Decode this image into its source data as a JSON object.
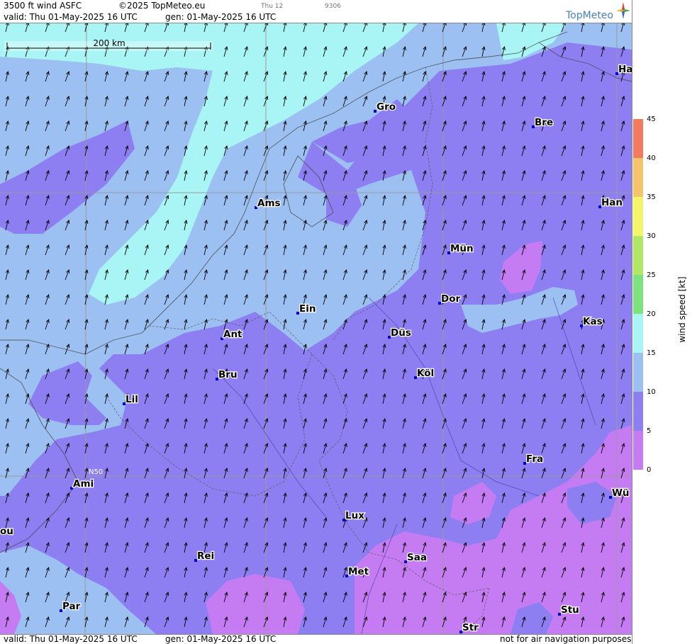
{
  "header": {
    "title": "3500 ft wind ASFC",
    "copyright": "©2025 TopMeteo.eu",
    "day_small": "Thu 12",
    "code_small": "9306",
    "valid": "valid:  Thu  01-May-2025  16 UTC",
    "gen": "gen: 01-May-2025 16 UTC",
    "logo": "TopMeteo"
  },
  "footer": {
    "valid": "valid:  Thu  01-May-2025  16 UTC",
    "gen": "gen: 01-May-2025 16 UTC",
    "disclaimer": "not for air navigation purposes"
  },
  "scale_bar": {
    "label": "200 km"
  },
  "grid_label": "N50",
  "legend": {
    "title": "wind speed  [kt]",
    "ticks": [
      "45",
      "40",
      "35",
      "30",
      "25",
      "20",
      "15",
      "10",
      "5",
      "0"
    ],
    "colors": {
      "0-5": "#c57cf2",
      "5-10": "#8d7ff2",
      "10-15": "#9cc0f2",
      "15-20": "#a9f5f5",
      "20-25": "#7de37d",
      "25-30": "#b0e864",
      "30-35": "#f5f56a",
      "35-40": "#f5c46a",
      "40-45": "#f27a5e"
    }
  },
  "cities": [
    {
      "name": "Ha"
    },
    {
      "name": "Gro"
    },
    {
      "name": "Bre"
    },
    {
      "name": "Ams"
    },
    {
      "name": "Han"
    },
    {
      "name": "Mün"
    },
    {
      "name": "Ein"
    },
    {
      "name": "Dor"
    },
    {
      "name": "Kas"
    },
    {
      "name": "Ant"
    },
    {
      "name": "Düs"
    },
    {
      "name": "Bru"
    },
    {
      "name": "Köl"
    },
    {
      "name": "Lil"
    },
    {
      "name": "Fra"
    },
    {
      "name": "Ami"
    },
    {
      "name": "Wü"
    },
    {
      "name": "ou"
    },
    {
      "name": "Lux"
    },
    {
      "name": "Rei"
    },
    {
      "name": "Saa"
    },
    {
      "name": "Met"
    },
    {
      "name": "Stu"
    },
    {
      "name": "Par"
    },
    {
      "name": "Str"
    }
  ]
}
